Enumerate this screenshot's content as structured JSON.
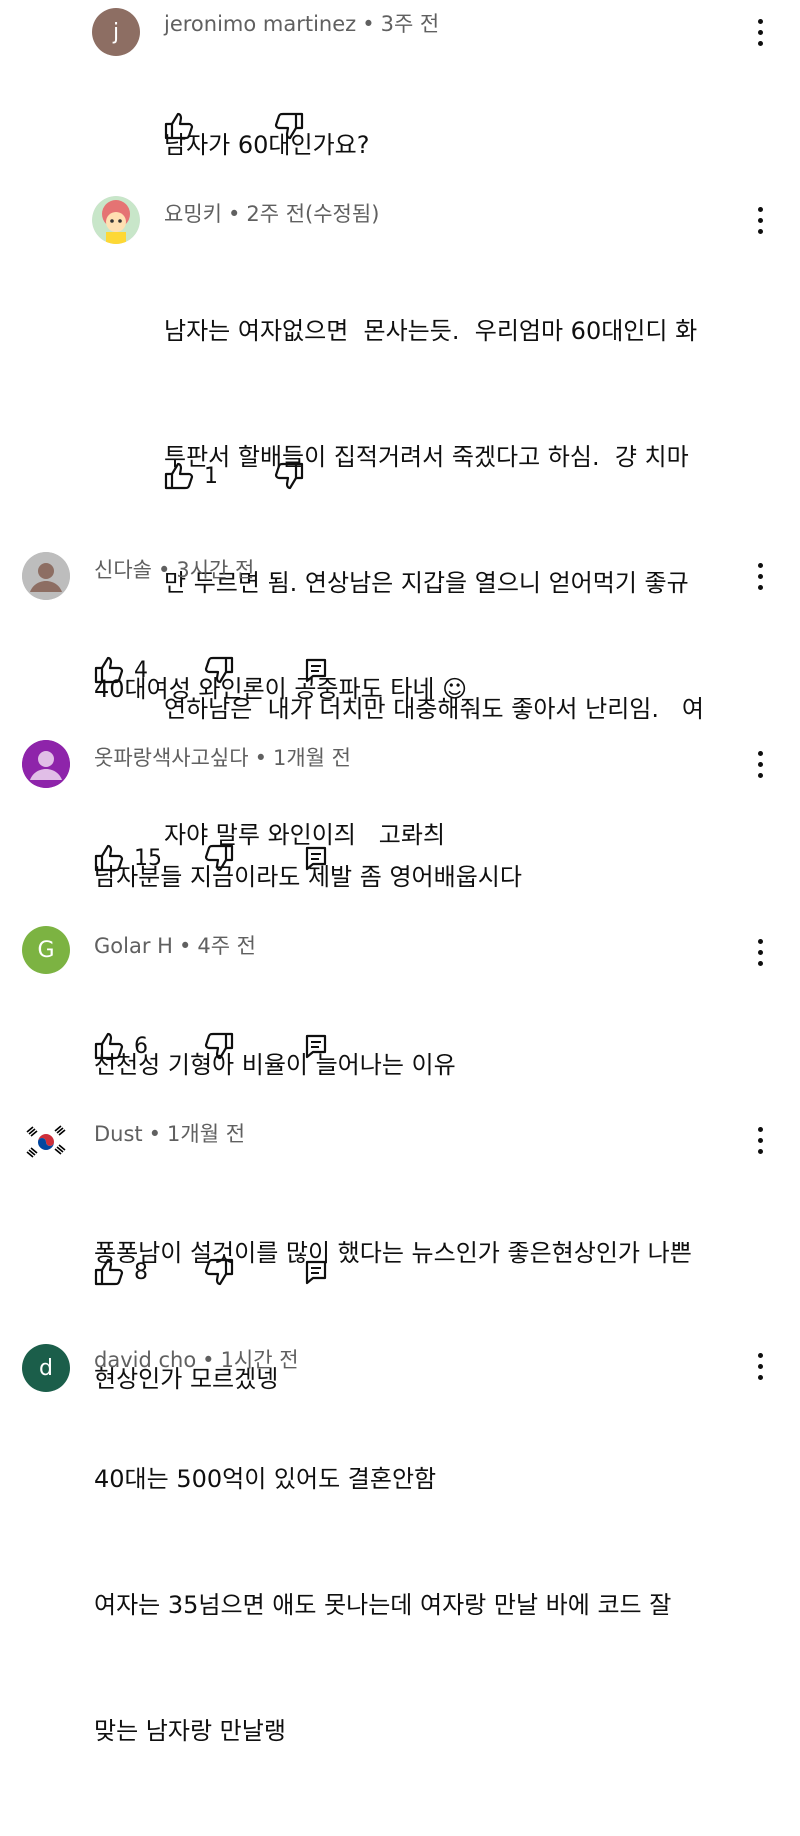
{
  "comments": [
    {
      "author": "jeronimo martinez",
      "time": "3주 전",
      "avatar_letter": "j",
      "avatar_color": "#8d6e63",
      "lines": [
        "남자가 60대인가요?"
      ],
      "likes": ""
    },
    {
      "author": "요밍키",
      "time": "2주 전(수정됨)",
      "avatar_color": "#e57373",
      "lines": [
        "남자는 여자없으면  몬사는듯.  우리엄마 60대인디 화",
        "투판서 할배들이 집적거려서 죽겠다고 하심.  걍 치마",
        "만 두르면 됨. 연상남은 지갑을 열으니 얻어먹기 좋규",
        "연하남은  내가 더치만 대충해줘도 좋아서 난리임.   여",
        "자야 말루 와인이즤   고롸츼"
      ],
      "likes": "1"
    },
    {
      "author": "신다솔",
      "time": "3시간 전",
      "avatar_color": "#bdbdbd",
      "lines": [
        "40대여성 와인론이 공중파도 타네 ☺"
      ],
      "likes": "4"
    },
    {
      "author": "옷파랑색사고싶다",
      "time": "1개월 전",
      "avatar_color": "#8e24aa",
      "lines": [
        "남자분들 지금이라도 제발 좀 영어배웁시다"
      ],
      "likes": "15"
    },
    {
      "author": "Golar H",
      "time": "4주 전",
      "avatar_letter": "G",
      "avatar_color": "#7cb342",
      "lines": [
        "선천성 기형아 비율이 늘어나는 이유"
      ],
      "likes": "6"
    },
    {
      "author": "Dust",
      "time": "1개월 전",
      "avatar_color": "#ffffff",
      "lines": [
        "퐁퐁남이 설것이를 많이 했다는 뉴스인가 좋은현상인가 나쁜",
        "현상인가 모르겠넹"
      ],
      "likes": "8"
    },
    {
      "author": "david cho",
      "time": "1시간 전",
      "avatar_letter": "d",
      "avatar_color": "#1b5e4a",
      "lines": [
        "40대는 500억이 있어도 결혼안함",
        "여자는 35넘으면 애도 못나는데 여자랑 만날 바에 코드 잘",
        "맞는 남자랑 만날랭"
      ],
      "likes": ""
    }
  ],
  "meta_separator": "•"
}
